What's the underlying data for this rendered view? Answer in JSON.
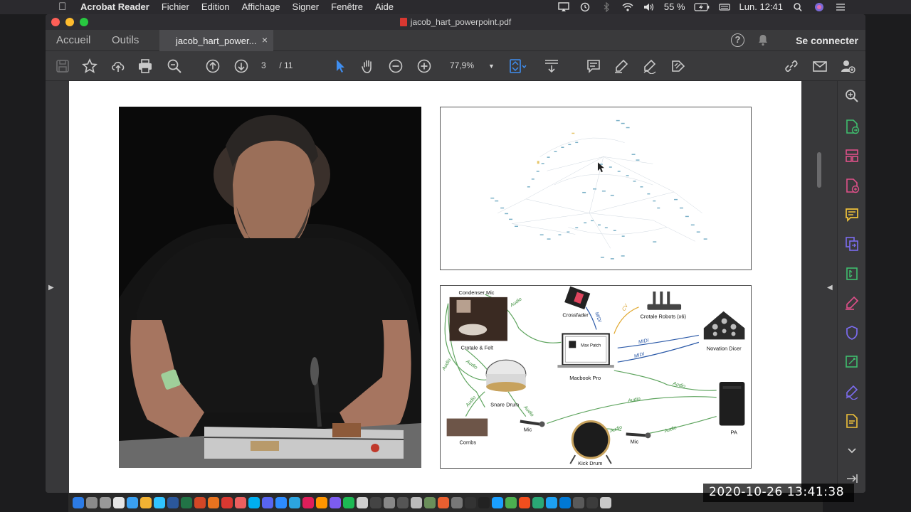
{
  "menubar": {
    "apple": "",
    "app": "Acrobat Reader",
    "items": [
      "Fichier",
      "Edition",
      "Affichage",
      "Signer",
      "Fenêtre",
      "Aide"
    ],
    "battery": "55 %",
    "clock": "Lun. 12:41"
  },
  "window": {
    "title": "jacob_hart_powerpoint.pdf"
  },
  "tabs": {
    "home": "Accueil",
    "tools": "Outils",
    "document": "jacob_hart_power...",
    "close": "×",
    "help": "?",
    "signin": "Se connecter"
  },
  "toolbar": {
    "page_current": "3",
    "page_total": "/ 11",
    "zoom": "77,9%"
  },
  "slide": {
    "setup_labels": {
      "condenser_mic": "Condenser Mic",
      "crotale_felt": "Crotale & Felt",
      "crossfader": "Crossfader",
      "crotale_robots": "Crotale Robots (x6)",
      "max_patch": "Max Patch",
      "macbook": "Macbook Pro",
      "novation": "Novation Dicer",
      "snare": "Snare Drum",
      "combs": "Combs",
      "mic1": "Mic",
      "mic2": "Mic",
      "kick": "Kick Drum",
      "pa": "PA",
      "audio": "Audio",
      "midi": "MIDI",
      "cv": "CV"
    }
  },
  "overlay": {
    "timestamp": "2020-10-26  13:41:38"
  },
  "colors": {
    "accent_blue": "#3f8ef0",
    "panel_green": "#3fbf6e",
    "panel_pink": "#e0508a",
    "panel_yellow": "#f0c23a",
    "panel_purple": "#7c6cf0"
  }
}
